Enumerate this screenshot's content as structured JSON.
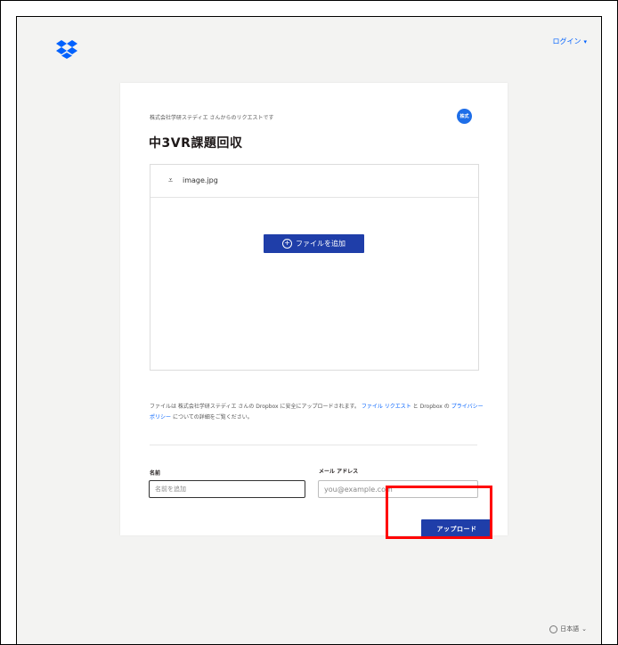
{
  "header": {
    "login_label": "ログイン",
    "login_caret": "▾",
    "logo_icon": "dropbox-logo-icon"
  },
  "request": {
    "requester_text": "株式会社学研ステディエ さんからのリクエストです",
    "badge_text": "株式",
    "title": "中3VR課題回収"
  },
  "dropzone": {
    "file_name": "image.jpg",
    "file_icon_glyph": "⩡",
    "add_button_label": "ファイルを追加",
    "add_button_icon": "plus-circle-icon"
  },
  "notice": {
    "text_before": "ファイルは 株式会社学研ステディエ さんの Dropbox に安全にアップロードされます。",
    "link_file_request": "ファイル リクエスト",
    "text_middle": "と Dropbox の",
    "link_privacy": "プライバシー ポリシー",
    "text_after": "についての詳細をご覧ください。"
  },
  "form": {
    "name_label": "名前",
    "name_placeholder": "名前を追加",
    "email_label": "メール アドレス",
    "email_placeholder": "you@example.com",
    "upload_button_label": "アップロード"
  },
  "footer": {
    "language_label": "日本語",
    "language_caret": "⌄"
  },
  "colors": {
    "accent": "#1f3ea9",
    "link": "#0061fe",
    "highlight": "#ff0000",
    "background": "#f3f3f2"
  }
}
